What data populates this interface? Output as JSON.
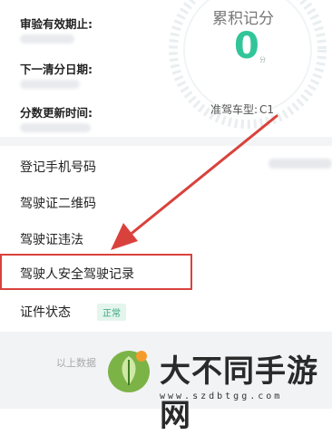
{
  "info": {
    "review_label": "审验有效期止:",
    "clear_label": "下一清分日期:",
    "update_label": "分数更新时间:"
  },
  "score": {
    "title": "累积记分",
    "value": "0",
    "unit": "分",
    "car_type_label": "准驾车型:",
    "car_type_value": "C1"
  },
  "menu": {
    "phone": "登记手机号码",
    "qrcode": "驾驶证二维码",
    "violation": "驾驶证违法",
    "safe_record": "驾驶人安全驾驶记录",
    "status": "证件状态",
    "status_badge": "正常"
  },
  "footer": {
    "note": "以上数据"
  },
  "watermark": {
    "text": "大不同手游网",
    "url": "www.szdbtgg.com"
  },
  "colors": {
    "accent": "#33c59a",
    "arrow": "#d9423c",
    "highlight": "#d9423c"
  }
}
